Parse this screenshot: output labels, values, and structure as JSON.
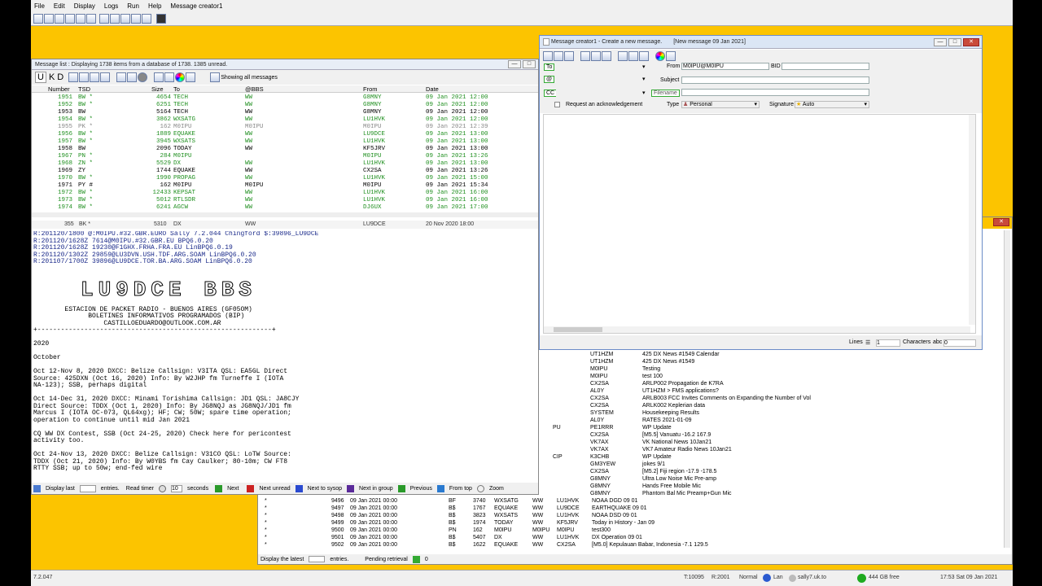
{
  "menu": [
    "File",
    "Edit",
    "Display",
    "Logs",
    "Run",
    "Help",
    "Message creator1"
  ],
  "msglist": {
    "title": "Message list : Displaying 1738 items from a database of 1738.  1385 unread.",
    "tabs": [
      "U",
      "K",
      "D"
    ],
    "showing": "Showing all messages",
    "headers": [
      "Number",
      "TSD",
      "Size",
      "To",
      "@BBS",
      "From",
      "Date"
    ],
    "rows": [
      [
        "1951",
        "BW *",
        "4654",
        "TECH",
        "WW",
        "G8MNY",
        "09 Jan 2021  12:00",
        "g"
      ],
      [
        "1952",
        "BW *",
        "6251",
        "TECH",
        "WW",
        "G8MNY",
        "09 Jan 2021  12:00",
        "g"
      ],
      [
        "1953",
        "BW",
        "5164",
        "TECH",
        "WW",
        "G8MNY",
        "09 Jan 2021  12:00",
        "bk"
      ],
      [
        "1954",
        "BW *",
        "3862",
        "WXSATG",
        "WW",
        "LU1HVK",
        "09 Jan 2021  12:00",
        "g"
      ],
      [
        "1955",
        "PK *",
        "162",
        "M0IPU",
        "M0IPU",
        "M0IPU",
        "09 Jan 2021  12:39",
        "gr"
      ],
      [
        "1956",
        "BW *",
        "1889",
        "EQUAKE",
        "WW",
        "LU9DCE",
        "09 Jan 2021  13:00",
        "g"
      ],
      [
        "1957",
        "BW *",
        "3945",
        "WXSATS",
        "WW",
        "LU1HVK",
        "09 Jan 2021  13:00",
        "g"
      ],
      [
        "1958",
        "BW",
        "2096",
        "TODAY",
        "WW",
        "KF5JRV",
        "09 Jan 2021  13:00",
        "bk"
      ],
      [
        "1967",
        "PN *",
        "284",
        "M0IPU",
        "",
        "M0IPU",
        "09 Jan 2021  13:26",
        "g"
      ],
      [
        "1968",
        "ZN *",
        "5529",
        "DX",
        "WW",
        "LU1HVK",
        "09 Jan 2021  13:00",
        "g"
      ],
      [
        "1969",
        "ZY",
        "1744",
        "EQUAKE",
        "WW",
        "CX2SA",
        "09 Jan 2021  13:26",
        "bk"
      ],
      [
        "1970",
        "BW *",
        "1990",
        "PROPAG",
        "WW",
        "LU1HVK",
        "09 Jan 2021  15:00",
        "g"
      ],
      [
        "1971",
        "PY #",
        "162",
        "M0IPU",
        "M0IPU",
        "M0IPU",
        "09 Jan 2021  15:34",
        "bk"
      ],
      [
        "1972",
        "BW *",
        "12433",
        "KEPSAT",
        "WW",
        "LU1HVK",
        "09 Jan 2021  16:00",
        "g"
      ],
      [
        "1973",
        "BW *",
        "5012",
        "RTLSDR",
        "WW",
        "LU1HVK",
        "09 Jan 2021  16:00",
        "g"
      ],
      [
        "1974",
        "BW *",
        "6241",
        "AGCW",
        "WW",
        "DJ6UX",
        "09 Jan 2021  17:00",
        "g"
      ]
    ],
    "selected": [
      "355",
      "BK *",
      "5310",
      "DX",
      "WW",
      "LU9DCE",
      "20 Nov 2020  18:00"
    ],
    "body": "R:201120/1800 @:M0IPU.#32.GBR.EURO Sally 7.2.044 Chingford $:39896_LU9DCE\nR:201120/1628Z 7614@M0IPU.#32.GBR.EU BPQ6.0.20\nR:201120/1628Z 19230@F1GHX.FRHA.FRA.EU LinBPQ6.0.19\nR:201120/1302Z 29859@LU3DVN.USH.TDF.ARG.SOAM LinBPQ6.0.20\nR:201107/1700Z 39896@LU9DCE.TOR.BA.ARG.SOAM LinBPQ6.0.20",
    "banner_text": "LU9DCE BBS",
    "body2": "        ESTACION DE PACKET RADIO - BUENOS AIRES (GF05OM)\n              BOLETINES INFORMATIVOS PROGRAMADOS (BIP)\n                  CASTILLOEDUARDO@OUTLOOK.COM.AR\n+------------------------------------------------------------+\n\n2020\n\nOctober\n\nOct 12-Nov 8, 2020 DXCC: Belize Callsign: V3ITA QSL: EA5GL Direct\nSource: 425DXN (Oct 16, 2020) Info: By W2JHP fm Turneffe I (IOTA\nNA-123); SSB, perhaps digital\n\nOct 14-Dec 31, 2020 DXCC: Minami Torishima Callsign: JD1 QSL: JA8CJY\nDirect Source: TDDX (Oct 1, 2020) Info: By JG8NQJ as JG8NQJ/JD1 fm\nMarcus I (IOTA OC-073, QL64xg); HF; CW; 50W; spare time operation;\noperation to continue until mid Jan 2021\n\nCQ WW DX Contest, SSB (Oct 24-25, 2020) Check here for pericontest\nactivity too.\n\nOct 24-Nov 13, 2020 DXCC: Belize Callsign: V31CO QSL: LoTW Source:\nTDDX (Oct 21, 2020) Info: By W0YBS fm Cay Caulker; 80-10m; CW FT8\nRTTY SSB; up to 50w; end-fed wire",
    "footer": {
      "display_last": "Display last",
      "entries": "entries.",
      "read_timer": "Read timer",
      "seconds_val": "10",
      "seconds": "seconds",
      "next": "Next",
      "next_unread": "Next unread",
      "next_sysop": "Next to sysop",
      "next_group": "Next in group",
      "previous": "Previous",
      "from_top": "From top",
      "zoom": "Zoom"
    }
  },
  "creator": {
    "title": "Message creator1 - Create a new message.",
    "subtitle": "[New message  09 Jan 2021]",
    "to": "To",
    "at": "@",
    "cc": "CC",
    "from_label": "From",
    "from_value": "M0IPU@M0IPU",
    "bid": "BID",
    "subject": "Subject",
    "filename": "Filename",
    "ack": "Request an acknowledgement",
    "type_label": "Type",
    "type_value": "Personal",
    "signature_label": "Signature",
    "signature_value": "Auto",
    "lines_label": "Lines",
    "lines_value": "1",
    "chars_label": "Characters",
    "chars_value": "0"
  },
  "rightlist": [
    [
      "UT1HZM",
      "425 DX News #1549 Calendar"
    ],
    [
      "UT1HZM",
      "425 DX News #1549"
    ],
    [
      "M0IPU",
      "Testing"
    ],
    [
      "M0IPU",
      "test 100"
    ],
    [
      "CX2SA",
      "ARLP002 Propagation de K7RA"
    ],
    [
      "AL0Y",
      "UT1HZM > FMS applications?"
    ],
    [
      "CX2SA",
      "ARLB003 FCC Invites Comments on Expanding the Number of Vol"
    ],
    [
      "CX2SA",
      "ARLK002 Keplerian data"
    ],
    [
      "SYSTEM",
      "Housekeeping Results"
    ],
    [
      "AL0Y",
      "RATES 2021-01-09"
    ],
    [
      "PE1RRR",
      "WP Update"
    ],
    [
      "CX2SA",
      "[M5.5] Vanuatu -16.2 167.9"
    ],
    [
      "VK7AX",
      "VK National News 10Jan21"
    ],
    [
      "VK7AX",
      "VK7 Amateur Radio News 10Jan21"
    ],
    [
      "K3CHB",
      "WP Update"
    ],
    [
      "GM3YEW",
      "jokes 9/1"
    ],
    [
      "CX2SA",
      "[M5.2] Fiji region -17.9 -178.5"
    ],
    [
      "G8MNY",
      "Ultra Low Noise Mic Pre-amp"
    ],
    [
      "G8MNY",
      "Hands Free Mobile Mic"
    ],
    [
      "G8MNY",
      "Phantom Bal Mic Preamp+Gun Mic"
    ]
  ],
  "leftfrag": [
    "PU",
    "CIP"
  ],
  "lowerlist": [
    [
      "9496",
      "09 Jan 2021  00:00",
      "BF",
      "3740",
      "WXSATG",
      "WW",
      "LU1HVK",
      "NOAA DGD 09 01"
    ],
    [
      "9497",
      "09 Jan 2021  00:00",
      "B$",
      "1767",
      "EQUAKE",
      "WW",
      "LU9DCE",
      "EARTHQUAKE 09 01"
    ],
    [
      "9498",
      "09 Jan 2021  00:00",
      "B$",
      "3823",
      "WXSATS",
      "WW",
      "LU1HVK",
      "NOAA DSD 09 01"
    ],
    [
      "9499",
      "09 Jan 2021  00:00",
      "B$",
      "1974",
      "TODAY",
      "WW",
      "KF5JRV",
      "Today in History - Jan 09"
    ],
    [
      "9500",
      "09 Jan 2021  00:00",
      "PN",
      "162",
      "M0IPU",
      "M0IPU",
      "M0IPU",
      "test300"
    ],
    [
      "9501",
      "09 Jan 2021  00:00",
      "B$",
      "5407",
      "DX",
      "WW",
      "LU1HVK",
      "DX Operation 09 01"
    ],
    [
      "9502",
      "09 Jan 2021  00:00",
      "B$",
      "1622",
      "EQUAKE",
      "WW",
      "CX2SA",
      "[M5.0] Kepulauan Babar, Indonesia -7.1 129.5"
    ]
  ],
  "lowerfooter": {
    "display": "Display the latest",
    "entries": "entries.",
    "pending": "Pending retrieval",
    "pending_val": "0"
  },
  "status": {
    "version": "7.2.047",
    "t": "T:10095",
    "r": "R:2001",
    "mode": "Normal",
    "lan": "Lan",
    "host": "sally7.uk.to",
    "disk": "444 GB free",
    "clock": "17:53 Sat 09 Jan 2021"
  }
}
